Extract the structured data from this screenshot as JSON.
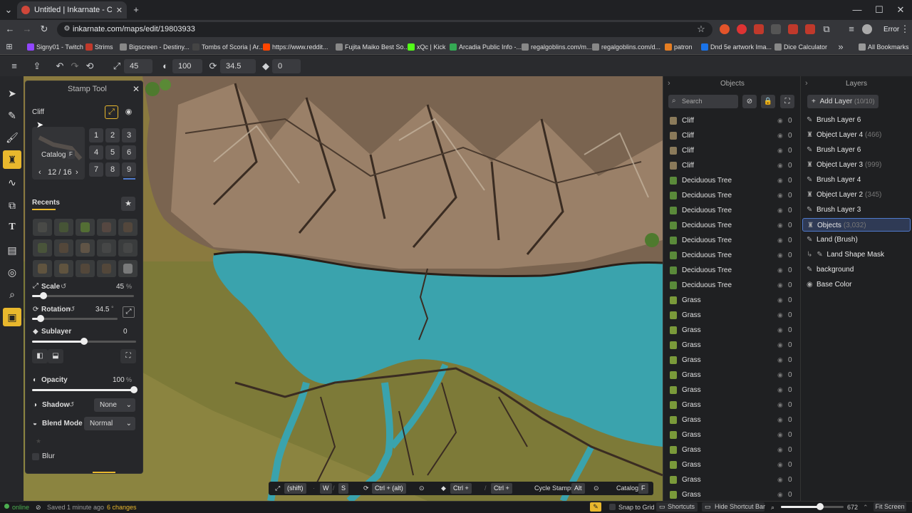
{
  "browser": {
    "tab_title": "Untitled | Inkarnate - Create Fa",
    "url": "inkarnate.com/maps/edit/19803933",
    "profile": "Error",
    "bookmarks": [
      {
        "label": "Signy01 - Twitch",
        "color": "#9146ff"
      },
      {
        "label": "Strims",
        "color": "#c0392b"
      },
      {
        "label": "Bigscreen - Destiny...",
        "color": "#888888"
      },
      {
        "label": "Tombs of Scoria | Ar...",
        "color": "#444444"
      },
      {
        "label": "https://www.reddit...",
        "color": "#ff4500"
      },
      {
        "label": "Fujita Maiko Best So...",
        "color": "#888888"
      },
      {
        "label": "xQc | Kick",
        "color": "#53fc18"
      },
      {
        "label": "Arcadia Public Info -...",
        "color": "#34a853"
      },
      {
        "label": "regalgoblins.com/m...",
        "color": "#888888"
      },
      {
        "label": "regalgoblins.com/d...",
        "color": "#888888"
      },
      {
        "label": "patron",
        "color": "#e67e22"
      },
      {
        "label": "Dnd 5e artwork Ima...",
        "color": "#1a73e8"
      },
      {
        "label": "Dice Calculator",
        "color": "#888888"
      }
    ],
    "all_bookmarks": "All Bookmarks"
  },
  "toolbar": {
    "size": "45",
    "opacity": "100",
    "rotation": "34.5",
    "sublayer": "0"
  },
  "stamp_panel": {
    "title": "Stamp Tool",
    "asset_name": "Cliff",
    "catalog_label": "Catalog",
    "catalog_key": "F",
    "page": "12 / 16",
    "numbers": [
      "1",
      "2",
      "3",
      "4",
      "5",
      "6",
      "7",
      "8",
      "9"
    ],
    "recents_label": "Recents",
    "scale_label": "Scale",
    "scale_value": "45",
    "scale_unit": "%",
    "scale_fraction": 0.11,
    "rotation_label": "Rotation",
    "rotation_value": "34.5",
    "rotation_unit": "°",
    "rotation_fraction": 0.1,
    "sublayer_label": "Sublayer",
    "sublayer_value": "0",
    "sublayer_fraction": 0.5,
    "opacity_label": "Opacity",
    "opacity_value": "100",
    "opacity_unit": "%",
    "opacity_fraction": 1.0,
    "shadow_label": "Shadow",
    "shadow_value": "None",
    "blend_label": "Blend Mode",
    "blend_value": "Normal",
    "blur_label": "Blur"
  },
  "objects_panel": {
    "title": "Objects",
    "search_placeholder": "Search",
    "items": [
      {
        "label": "Cliff",
        "count": "0",
        "color": "#8a7a5a"
      },
      {
        "label": "Cliff",
        "count": "0",
        "color": "#8a7a5a"
      },
      {
        "label": "Cliff",
        "count": "0",
        "color": "#8a7a5a"
      },
      {
        "label": "Cliff",
        "count": "0",
        "color": "#8a7a5a"
      },
      {
        "label": "Deciduous Tree",
        "count": "0",
        "color": "#5a8a3a"
      },
      {
        "label": "Deciduous Tree",
        "count": "0",
        "color": "#5a8a3a"
      },
      {
        "label": "Deciduous Tree",
        "count": "0",
        "color": "#5a8a3a"
      },
      {
        "label": "Deciduous Tree",
        "count": "0",
        "color": "#5a8a3a"
      },
      {
        "label": "Deciduous Tree",
        "count": "0",
        "color": "#5a8a3a"
      },
      {
        "label": "Deciduous Tree",
        "count": "0",
        "color": "#5a8a3a"
      },
      {
        "label": "Deciduous Tree",
        "count": "0",
        "color": "#5a8a3a"
      },
      {
        "label": "Deciduous Tree",
        "count": "0",
        "color": "#5a8a3a"
      },
      {
        "label": "Grass",
        "count": "0",
        "color": "#7a9a3a"
      },
      {
        "label": "Grass",
        "count": "0",
        "color": "#7a9a3a"
      },
      {
        "label": "Grass",
        "count": "0",
        "color": "#7a9a3a"
      },
      {
        "label": "Grass",
        "count": "0",
        "color": "#7a9a3a"
      },
      {
        "label": "Grass",
        "count": "0",
        "color": "#7a9a3a"
      },
      {
        "label": "Grass",
        "count": "0",
        "color": "#7a9a3a"
      },
      {
        "label": "Grass",
        "count": "0",
        "color": "#7a9a3a"
      },
      {
        "label": "Grass",
        "count": "0",
        "color": "#7a9a3a"
      },
      {
        "label": "Grass",
        "count": "0",
        "color": "#7a9a3a"
      },
      {
        "label": "Grass",
        "count": "0",
        "color": "#7a9a3a"
      },
      {
        "label": "Grass",
        "count": "0",
        "color": "#7a9a3a"
      },
      {
        "label": "Grass",
        "count": "0",
        "color": "#7a9a3a"
      },
      {
        "label": "Grass",
        "count": "0",
        "color": "#7a9a3a"
      },
      {
        "label": "Grass",
        "count": "0",
        "color": "#7a9a3a"
      }
    ]
  },
  "layers_panel": {
    "title": "Layers",
    "add_label": "Add Layer",
    "add_count": "(10/10)",
    "items": [
      {
        "label": "Brush Layer 6",
        "count": "",
        "icon": "brush",
        "indent": false,
        "selected": false
      },
      {
        "label": "Object Layer 4",
        "count": "(466)",
        "icon": "object",
        "indent": false,
        "selected": false
      },
      {
        "label": "Brush Layer 6",
        "count": "",
        "icon": "brush",
        "indent": false,
        "selected": false
      },
      {
        "label": "Object Layer 3",
        "count": "(999)",
        "icon": "object",
        "indent": false,
        "selected": false
      },
      {
        "label": "Brush Layer 4",
        "count": "",
        "icon": "brush",
        "indent": false,
        "selected": false
      },
      {
        "label": "Object Layer 2",
        "count": "(345)",
        "icon": "object",
        "indent": false,
        "selected": false
      },
      {
        "label": "Brush Layer 3",
        "count": "",
        "icon": "brush",
        "indent": false,
        "selected": false
      },
      {
        "label": "Objects",
        "count": "(3,032)",
        "icon": "object",
        "indent": false,
        "selected": true
      },
      {
        "label": "Land (Brush)",
        "count": "",
        "icon": "brush",
        "indent": false,
        "selected": false
      },
      {
        "label": "Land Shape Mask",
        "count": "",
        "icon": "mask",
        "indent": true,
        "selected": false
      },
      {
        "label": "background",
        "count": "",
        "icon": "brush",
        "indent": false,
        "selected": false
      },
      {
        "label": "Base Color",
        "count": "",
        "icon": "palette",
        "indent": false,
        "selected": false
      }
    ]
  },
  "shortcut_bar": {
    "shift_key": "(shift)",
    "w_key": "W",
    "s_key": "S",
    "ctrl_alt_key": "Ctrl + (alt)",
    "ctrl_plus_key1": "Ctrl +",
    "ctrl_plus_key2": "Ctrl +",
    "cycle_label": "Cycle Stamps",
    "alt_key": "Alt",
    "catalog_label": "Catalog",
    "catalog_key": "F"
  },
  "status_bar": {
    "online": "online",
    "saved": "Saved 1 minute ago",
    "changes": "6 changes",
    "snap": "Snap to Grid",
    "shortcuts": "Shortcuts",
    "hide_shortcut": "Hide Shortcut Bar",
    "zoom": "672",
    "fit": "Fit Screen",
    "zoom_fraction": 0.62
  },
  "colors": {
    "accent": "#e9b82d",
    "water": "#3aa3ad",
    "selected_layer": "#4f7acc",
    "changes": "#e9b82d",
    "online": "#4caf50"
  }
}
